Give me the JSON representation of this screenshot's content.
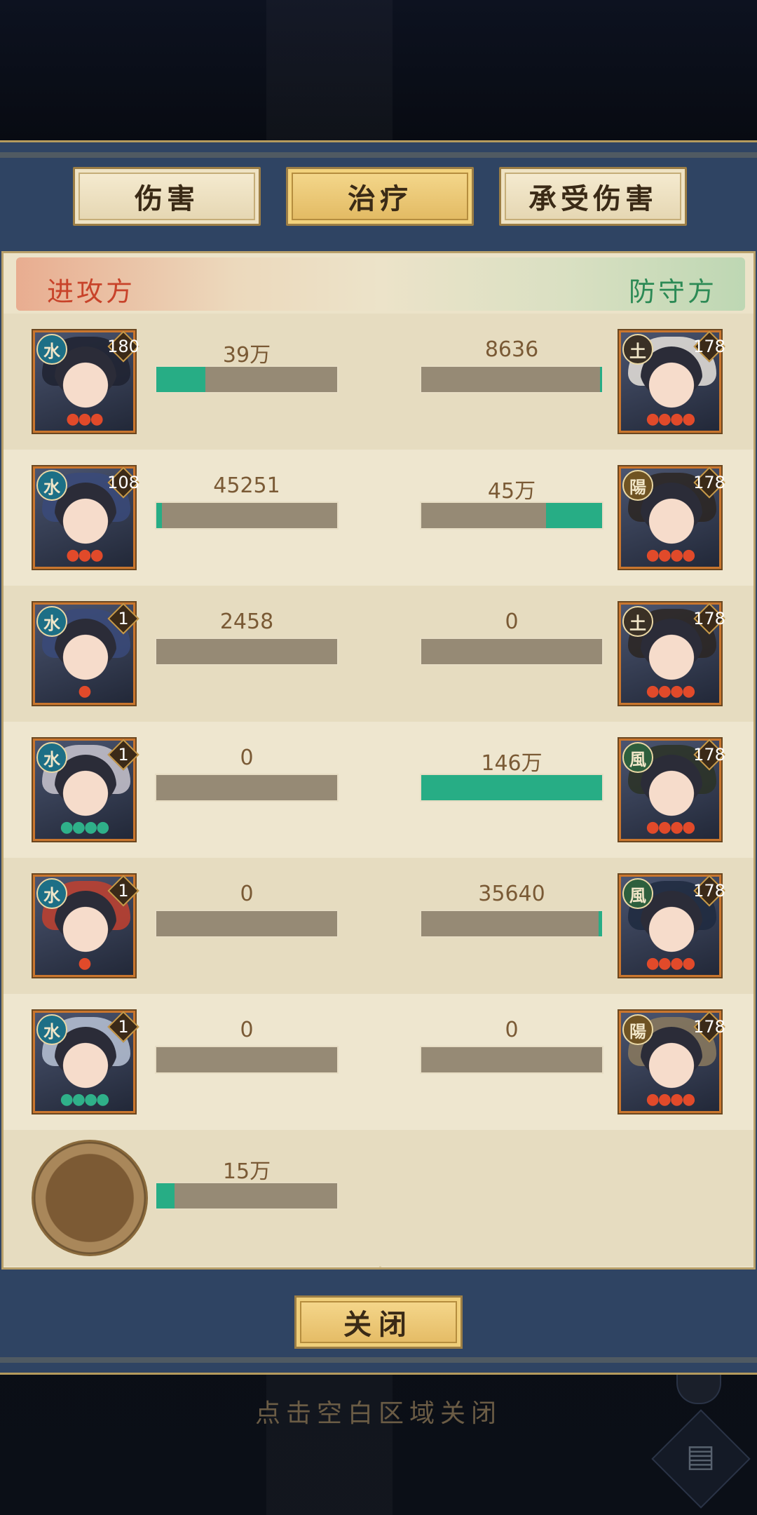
{
  "tabs": [
    {
      "label": "伤害",
      "active": false
    },
    {
      "label": "治疗",
      "active": true
    },
    {
      "label": "承受伤害",
      "active": false
    }
  ],
  "sides": {
    "attacker": "进攻方",
    "defender": "防守方"
  },
  "rows": [
    {
      "left": {
        "level": "180",
        "element": "水",
        "stars": "ccc",
        "star_color": "red",
        "value": "39万",
        "fill": 0.27
      },
      "right": {
        "level": "178",
        "element": "土",
        "stars": "cccc",
        "star_color": "red",
        "value": "8636",
        "fill": 0.01
      }
    },
    {
      "left": {
        "level": "108",
        "element": "水",
        "stars": "ccc",
        "star_color": "red",
        "value": "45251",
        "fill": 0.03
      },
      "right": {
        "level": "178",
        "element": "陽",
        "stars": "cccc",
        "star_color": "red",
        "value": "45万",
        "fill": 0.31
      }
    },
    {
      "left": {
        "level": "1",
        "element": "水",
        "stars": "c",
        "star_color": "red",
        "value": "2458",
        "fill": 0.0
      },
      "right": {
        "level": "178",
        "element": "土",
        "stars": "cccc",
        "star_color": "red",
        "value": "0",
        "fill": 0.0
      }
    },
    {
      "left": {
        "level": "1",
        "element": "水",
        "stars": "cccc",
        "star_color": "green",
        "value": "0",
        "fill": 0.0
      },
      "right": {
        "level": "178",
        "element": "風",
        "stars": "cccc",
        "star_color": "red",
        "value": "146万",
        "fill": 1.0
      }
    },
    {
      "left": {
        "level": "1",
        "element": "水",
        "stars": "c",
        "star_color": "red",
        "value": "0",
        "fill": 0.0
      },
      "right": {
        "level": "178",
        "element": "風",
        "stars": "cccc",
        "star_color": "red",
        "value": "35640",
        "fill": 0.02
      }
    },
    {
      "left": {
        "level": "1",
        "element": "水",
        "stars": "cccc",
        "star_color": "green",
        "value": "0",
        "fill": 0.0
      },
      "right": {
        "level": "178",
        "element": "陽",
        "stars": "cccc",
        "star_color": "red",
        "value": "0",
        "fill": 0.0
      }
    }
  ],
  "pet": {
    "value": "15万",
    "fill": 0.1
  },
  "close_label": "关闭",
  "hint": "点击空白区域关闭",
  "colors": {
    "bar_fill": "#27ad85",
    "bar_bg": "#968a75",
    "panel": "#2f4463",
    "attacker": "#c8432a",
    "defender": "#2c8a55"
  }
}
